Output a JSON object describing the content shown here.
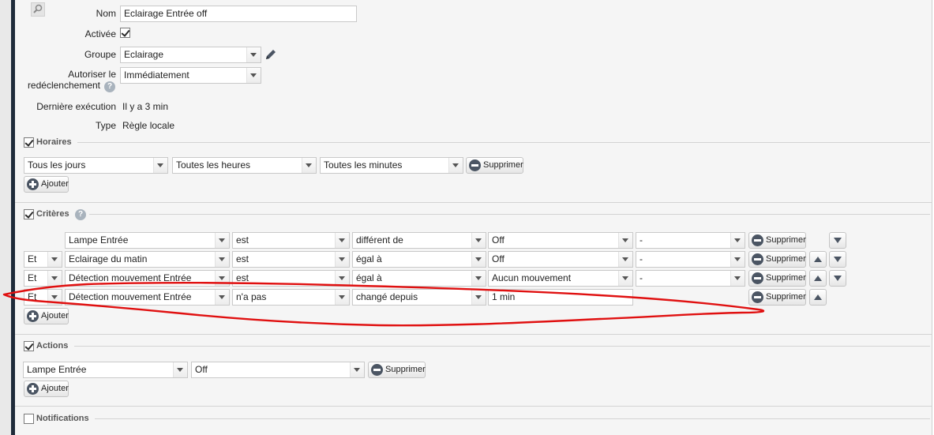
{
  "form": {
    "nom_label": "Nom",
    "nom_value": "Eclairage Entrée off",
    "activee_label": "Activée",
    "groupe_label": "Groupe",
    "groupe_value": "Eclairage",
    "autoriser_label_1": "Autoriser le",
    "autoriser_label_2": "redéclenchement",
    "autoriser_value": "Immédiatement",
    "derniere_label": "Dernière exécution",
    "derniere_value": "Il y a 3 min",
    "type_label": "Type",
    "type_value": "Règle locale"
  },
  "horaires": {
    "title": "Horaires",
    "jours": "Tous les jours",
    "heures": "Toutes les heures",
    "minutes": "Toutes les minutes",
    "supprimer": "Supprimer",
    "ajouter": "Ajouter"
  },
  "criteres": {
    "title": "Critères",
    "rows": [
      {
        "conj": "",
        "device": "Lampe Entrée",
        "verb": "est",
        "op": "différent de",
        "value": "Off",
        "extra": "-",
        "supprimer": "Supprimer"
      },
      {
        "conj": "Et",
        "device": "Eclairage du matin",
        "verb": "est",
        "op": "égal à",
        "value": "Off",
        "extra": "-",
        "supprimer": "Supprimer"
      },
      {
        "conj": "Et",
        "device": "Détection mouvement Entrée",
        "verb": "est",
        "op": "égal à",
        "value": "Aucun mouvement",
        "extra": "-",
        "supprimer": "Supprimer"
      },
      {
        "conj": "Et",
        "device": "Détection mouvement Entrée",
        "verb": "n'a pas",
        "op": "changé depuis",
        "value": "1 min",
        "extra": "",
        "supprimer": "Supprimer"
      }
    ],
    "ajouter": "Ajouter"
  },
  "actions": {
    "title": "Actions",
    "device": "Lampe Entrée",
    "value": "Off",
    "supprimer": "Supprimer",
    "ajouter": "Ajouter"
  },
  "notifications": {
    "title": "Notifications"
  },
  "colors": {
    "annotation": "#e01010"
  }
}
